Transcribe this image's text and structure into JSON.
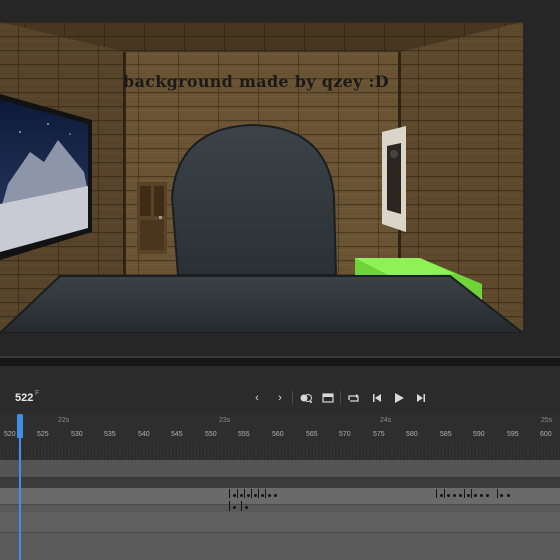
{
  "stage": {
    "caption": "background made by qzey :D"
  },
  "toolbar": {
    "frame_counter": "522",
    "frame_suffix": "F",
    "buttons": [
      "prev-frame-icon",
      "next-frame-icon",
      "onion-skin-icon",
      "center-frame-icon",
      "loop-icon",
      "step-back-icon",
      "play-icon",
      "step-forward-icon"
    ]
  },
  "ruler": {
    "seconds": [
      "22s",
      "23s",
      "24s",
      "25s"
    ],
    "frames": [
      "520",
      "525",
      "530",
      "535",
      "540",
      "545",
      "550",
      "555",
      "560",
      "565",
      "570",
      "575",
      "580",
      "585",
      "590",
      "595",
      "600"
    ]
  },
  "timeline": {
    "current_frame": 522
  },
  "colors": {
    "playhead": "#3f8ee8",
    "panel": "#2b2b2b"
  }
}
